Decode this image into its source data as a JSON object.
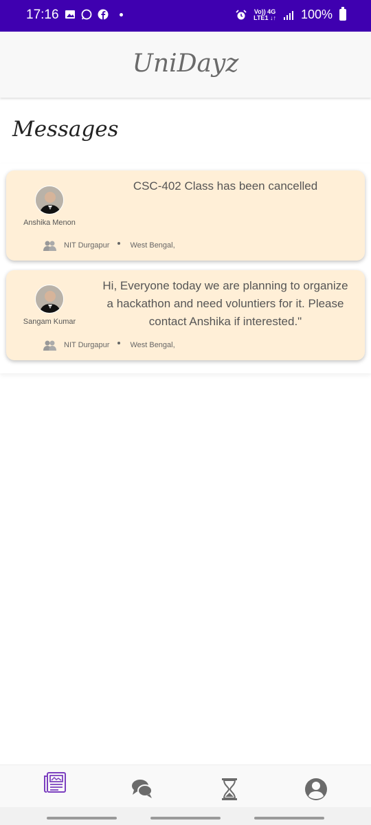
{
  "status_bar": {
    "time": "17:16",
    "battery": "100%",
    "net_top": "Vo)) 4G",
    "net_bottom": "LTE1 ↓↑"
  },
  "header": {
    "app_title": "UniDayz"
  },
  "page": {
    "title": "Messages"
  },
  "messages": [
    {
      "sender": "Anshika Menon",
      "text": "CSC-402 Class has been cancelled",
      "college": "NIT Durgapur",
      "state": "West Bengal,"
    },
    {
      "sender": "Sangam Kumar",
      "text": "Hi, Everyone today we are planning to organize a hackathon and need voluntiers for it. Please contact Anshika if interested.\"",
      "college": "NIT Durgapur",
      "state": "West Bengal,"
    }
  ],
  "icons": {
    "feed": "newspaper-icon",
    "chat": "chat-bubbles-icon",
    "hourglass": "hourglass-icon",
    "profile": "account-circle-icon",
    "group": "group-icon"
  },
  "colors": {
    "status_bar": "#3f00b0",
    "card_bg": "#ffefd7",
    "nav_active": "#7b3fbf",
    "nav_inactive": "#6b6b6b"
  }
}
